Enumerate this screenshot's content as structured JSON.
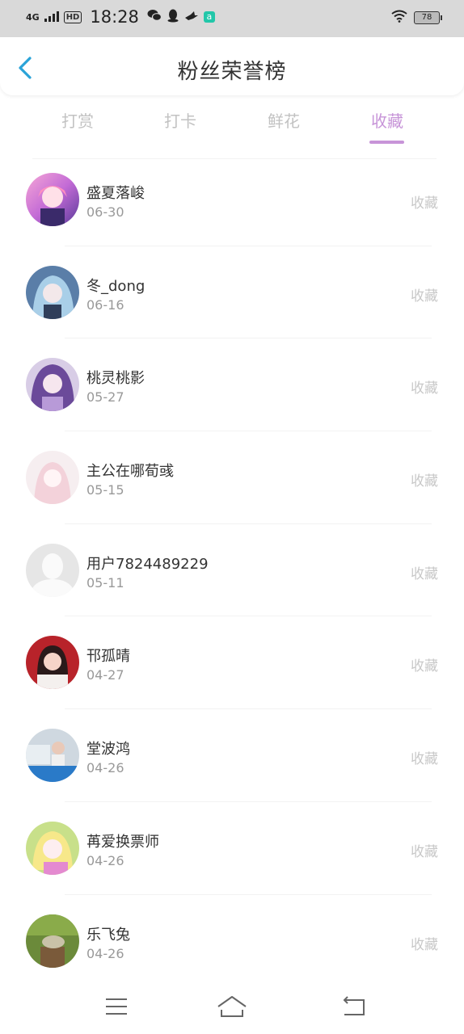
{
  "status_bar": {
    "network": "4G",
    "hd": "HD",
    "time": "18:28",
    "battery": "78"
  },
  "header": {
    "title": "粉丝荣誉榜"
  },
  "tabs": [
    {
      "label": "打赏",
      "active": false
    },
    {
      "label": "打卡",
      "active": false
    },
    {
      "label": "鲜花",
      "active": false
    },
    {
      "label": "收藏",
      "active": true
    }
  ],
  "fans": [
    {
      "name": "盛夏落峻",
      "date": "06-30",
      "action": "收藏",
      "avatar": "anime-pink-avatar"
    },
    {
      "name": "冬_dong",
      "date": "06-16",
      "action": "收藏",
      "avatar": "anime-blue-avatar"
    },
    {
      "name": "桃灵桃影",
      "date": "05-27",
      "action": "收藏",
      "avatar": "anime-purple-avatar"
    },
    {
      "name": "主公在哪荀彧",
      "date": "05-15",
      "action": "收藏",
      "avatar": "anime-light-avatar"
    },
    {
      "name": "用户7824489229",
      "date": "05-11",
      "action": "收藏",
      "avatar": "default-avatar"
    },
    {
      "name": "邗孤晴",
      "date": "04-27",
      "action": "收藏",
      "avatar": "photo-red-avatar"
    },
    {
      "name": "堂波鸿",
      "date": "04-26",
      "action": "收藏",
      "avatar": "photo-street-avatar"
    },
    {
      "name": "苒爱换票师",
      "date": "04-26",
      "action": "收藏",
      "avatar": "anime-yellow-avatar"
    },
    {
      "name": "乐飞兔",
      "date": "04-26",
      "action": "收藏",
      "avatar": "photo-green-avatar"
    }
  ],
  "colors": {
    "accent": "#c794d8",
    "back_arrow": "#2aa3d8",
    "inactive_tab": "#c2c2c2",
    "action_text": "#c8c8c8"
  }
}
